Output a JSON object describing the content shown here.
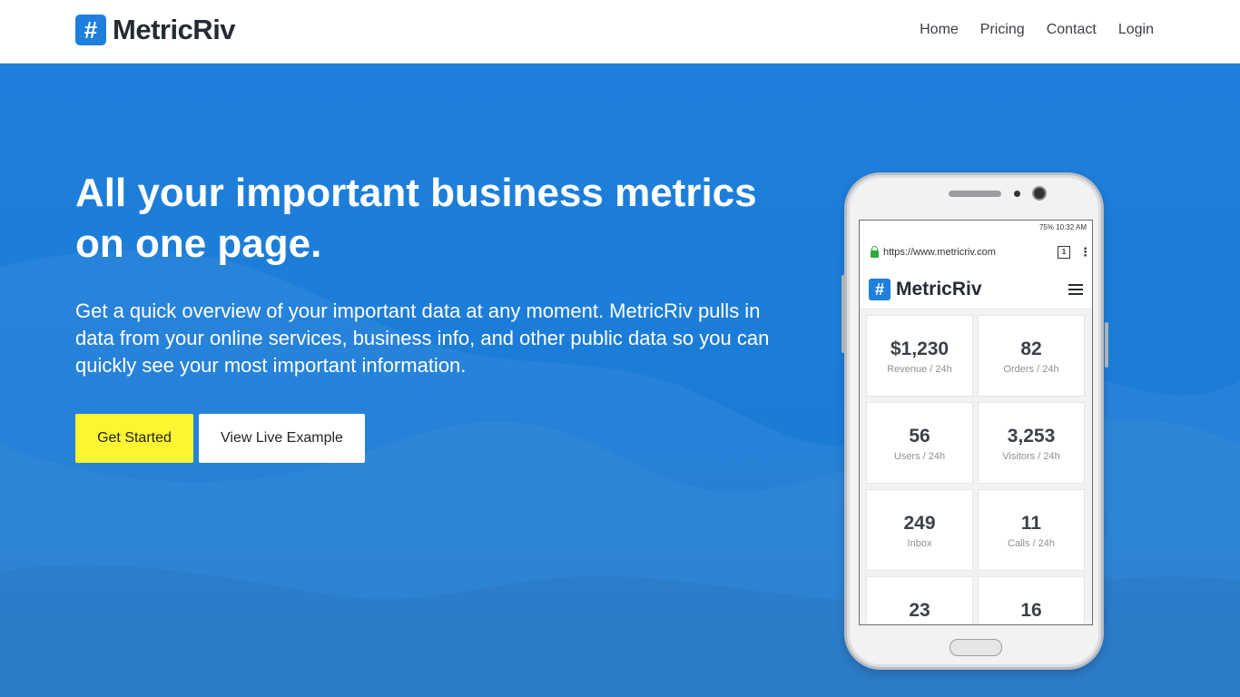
{
  "brand": {
    "mark": "#",
    "name": "MetricRiv"
  },
  "nav": {
    "items": [
      "Home",
      "Pricing",
      "Contact",
      "Login"
    ]
  },
  "hero": {
    "title": "All your important business metrics on one page.",
    "subtitle": "Get a quick overview of your important data at any moment. MetricRiv pulls in data from your online services, business info, and other public data so you can quickly see your most important information.",
    "primary_button": "Get Started",
    "secondary_button": "View Live Example"
  },
  "phone": {
    "status": "75%  10:32 AM",
    "url": "https://www.metricriv.com",
    "tab_count": "1",
    "app_mark": "#",
    "app_title": "MetricRiv",
    "cards": [
      {
        "value": "$1,230",
        "label": "Revenue / 24h"
      },
      {
        "value": "82",
        "label": "Orders / 24h"
      },
      {
        "value": "56",
        "label": "Users / 24h"
      },
      {
        "value": "3,253",
        "label": "Visitors / 24h"
      },
      {
        "value": "249",
        "label": "Inbox"
      },
      {
        "value": "11",
        "label": "Calls / 24h"
      },
      {
        "value": "23",
        "label": ""
      },
      {
        "value": "16",
        "label": ""
      }
    ]
  },
  "colors": {
    "primary": "#1e80dc",
    "accent_button": "#fbf532"
  }
}
